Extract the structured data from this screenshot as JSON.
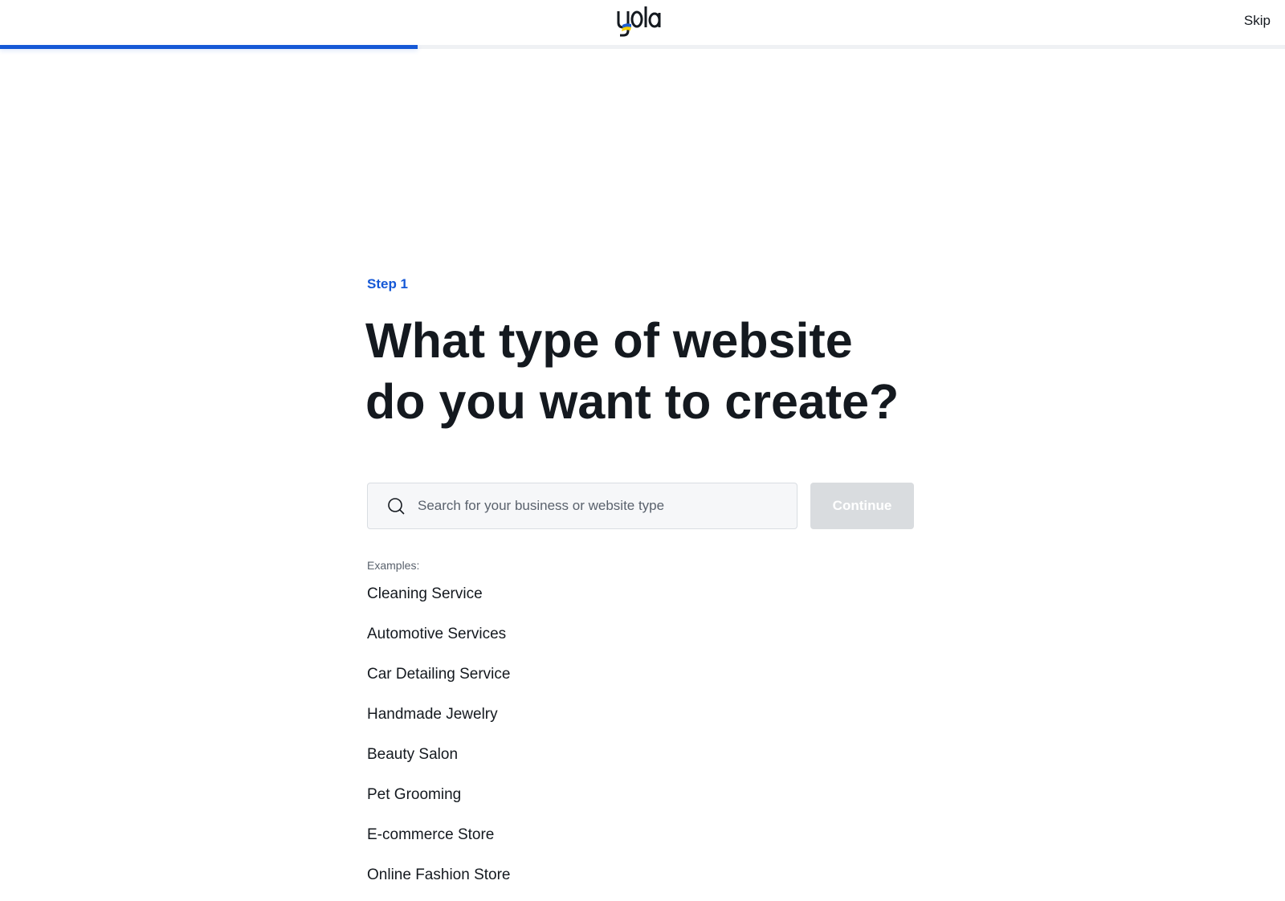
{
  "header": {
    "logo_text": "yola",
    "skip_label": "Skip"
  },
  "progress": {
    "fraction": 0.325,
    "color": "#1558d6"
  },
  "main": {
    "step_label": "Step 1",
    "title": "What type of website do you want to create?",
    "search": {
      "icon": "search-icon",
      "value": "",
      "placeholder": "Search for your business or website type"
    },
    "continue_label": "Continue",
    "examples_label": "Examples:",
    "examples": [
      "Cleaning Service",
      "Automotive Services",
      "Car Detailing Service",
      "Handmade Jewelry",
      "Beauty Salon",
      "Pet Grooming",
      "E-commerce Store",
      "Online Fashion Store"
    ]
  },
  "colors": {
    "accent": "#1558d6",
    "text": "#14191f",
    "muted": "#5a626d",
    "button_disabled": "#d9dcdf",
    "flag_blue": "#1f5fd1",
    "flag_yellow": "#f5d000"
  }
}
